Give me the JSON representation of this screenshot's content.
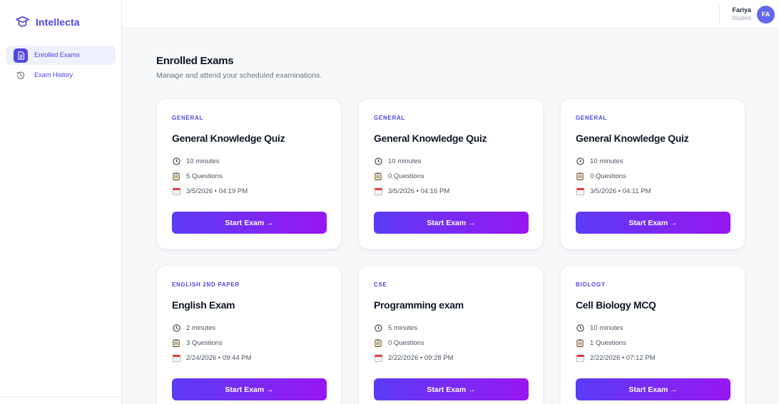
{
  "brand": {
    "name": "Intellecta"
  },
  "sidebar": {
    "items": [
      {
        "label": "Enrolled Exams",
        "icon": "document-icon",
        "active": true
      },
      {
        "label": "Exam History",
        "icon": "history-icon",
        "active": false
      }
    ]
  },
  "user": {
    "name": "Fariya",
    "role": "Student",
    "initials": "FA"
  },
  "page": {
    "title": "Enrolled Exams",
    "subtitle": "Manage and attend your scheduled examinations."
  },
  "exams": [
    {
      "category": "GENERAL",
      "title": "General Knowledge Quiz",
      "duration": "10 minutes",
      "questions": "5 Questions",
      "date": "3/5/2026",
      "time": "04:19 PM",
      "datetime": "3/5/2026 • 04:19 PM",
      "button": "Start Exam →"
    },
    {
      "category": "GENERAL",
      "title": "General Knowledge Quiz",
      "duration": "10 minutes",
      "questions": "0 Questions",
      "date": "3/5/2026",
      "time": "04:16 PM",
      "datetime": "3/5/2026 • 04:16 PM",
      "button": "Start Exam →"
    },
    {
      "category": "GENERAL",
      "title": "General Knowledge Quiz",
      "duration": "10 minutes",
      "questions": "0 Questions",
      "date": "3/5/2026",
      "time": "04:11 PM",
      "datetime": "3/5/2026 • 04:11 PM",
      "button": "Start Exam →"
    },
    {
      "category": "ENGLISH 2ND PAPER",
      "title": "English Exam",
      "duration": "2 minutes",
      "questions": "3 Questions",
      "date": "2/24/2026",
      "time": "09:44 PM",
      "datetime": "2/24/2026 • 09:44 PM",
      "button": "Start Exam →"
    },
    {
      "category": "CSE",
      "title": "Programming exam",
      "duration": "5 minutes",
      "questions": "0 Questions",
      "date": "2/22/2026",
      "time": "09:28 PM",
      "datetime": "2/22/2026 • 09:28 PM",
      "button": "Start Exam →"
    },
    {
      "category": "BIOLOGY",
      "title": "Cell Biology MCQ",
      "duration": "10 minutes",
      "questions": "1 Questions",
      "date": "2/22/2026",
      "time": "07:12 PM",
      "datetime": "2/22/2026 • 07:12 PM",
      "button": "Start Exam →"
    }
  ],
  "colors": {
    "accent": "#4f46e5",
    "button_gradient_start": "#5b3cf6",
    "button_gradient_end": "#9717f0",
    "avatar": "#6366f1",
    "background": "#f7f8fa"
  }
}
